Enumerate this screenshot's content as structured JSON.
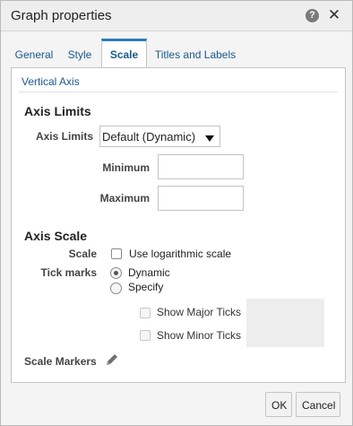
{
  "dialog": {
    "title": "Graph properties",
    "icons": {
      "help": "help-icon",
      "close": "close-icon"
    },
    "help_glyph": "?",
    "close_glyph": "✕"
  },
  "tabs": [
    {
      "label": "General",
      "active": false
    },
    {
      "label": "Style",
      "active": false
    },
    {
      "label": "Scale",
      "active": true
    },
    {
      "label": "Titles and Labels",
      "active": false
    }
  ],
  "vertical_axis": {
    "section_title": "Vertical Axis",
    "axis_limits": {
      "group_title": "Axis Limits",
      "label": "Axis Limits",
      "selected": "Default (Dynamic)",
      "minimum_label": "Minimum",
      "minimum_value": "",
      "maximum_label": "Maximum",
      "maximum_value": ""
    },
    "axis_scale": {
      "group_title": "Axis Scale",
      "scale_label": "Scale",
      "log_scale_label": "Use logarithmic scale",
      "log_scale_checked": false,
      "tick_marks_label": "Tick marks",
      "tick_options": [
        "Dynamic",
        "Specify"
      ],
      "tick_selected": "Dynamic",
      "show_major_ticks_label": "Show Major Ticks",
      "show_minor_ticks_label": "Show Minor Ticks"
    },
    "scale_markers_label": "Scale Markers",
    "scale_markers_icon": "pencil-icon"
  },
  "footer": {
    "ok_label": "OK",
    "cancel_label": "Cancel"
  },
  "colors": {
    "accent": "#2a7bc0",
    "link": "#1a5a8e"
  }
}
